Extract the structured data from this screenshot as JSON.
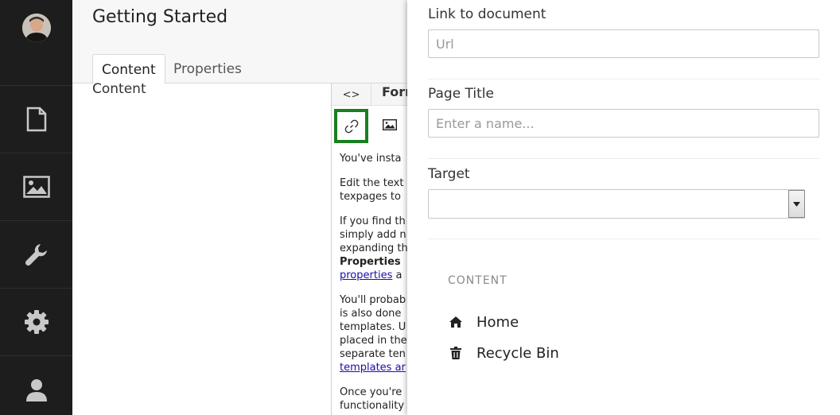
{
  "header": {
    "page_title": "Getting Started",
    "tabs": [
      {
        "label": "Content",
        "active": true
      },
      {
        "label": "Properties",
        "active": false
      }
    ]
  },
  "main": {
    "content_label": "Content"
  },
  "leftnav": {
    "items": [
      {
        "icon": "document-icon"
      },
      {
        "icon": "image-icon"
      },
      {
        "icon": "wrench-icon"
      },
      {
        "icon": "gear-icon"
      },
      {
        "icon": "user-icon"
      }
    ]
  },
  "editor": {
    "source_label": "<>",
    "format_label": "Form",
    "body": {
      "p1": "You've insta",
      "p2_l1": "Edit the text",
      "p2_l2": "texpages to",
      "p3_l1": "If you find th",
      "p3_l2": "simply add n",
      "p3_l3": "expanding th",
      "p3_bold": "Properties",
      "p3_link": "properties",
      "p3_after": " a",
      "p4_l1": "You'll probab",
      "p4_l2": "is also done",
      "p4_l3": "templates. U",
      "p4_l4": "placed in the",
      "p4_l5": "separate ten",
      "p4_link": "templates ar",
      "p5_l1": "Once you're",
      "p5_l2": "functionality"
    }
  },
  "panel": {
    "link_label": "Link to document",
    "url_placeholder": "Url",
    "url_value": "",
    "title_label": "Page Title",
    "title_placeholder": "Enter a name...",
    "title_value": "",
    "target_label": "Target",
    "target_value": "",
    "section_header": "CONTENT",
    "tree": [
      {
        "label": "Home",
        "icon": "home-icon"
      },
      {
        "label": "Recycle Bin",
        "icon": "trash-icon"
      }
    ]
  },
  "colors": {
    "nav_bg": "#1d1d1d",
    "nav_icon": "#c8c8c8",
    "highlight": "#18801f",
    "link": "#1a0dab"
  }
}
